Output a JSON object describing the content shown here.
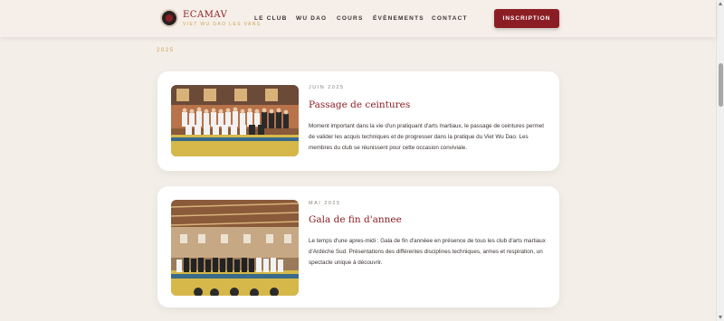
{
  "header": {
    "brand_title": "ECAMAV",
    "brand_subtitle": "VIET WU DAO LES VANS",
    "nav": [
      "LE CLUB",
      "WU DAO",
      "COURS",
      "ÉVÈNEMENTS",
      "CONTACT"
    ],
    "cta_label": "INSCRIPTION"
  },
  "year_label": "2025",
  "events": [
    {
      "date": "JUIN 2025",
      "title": "Passage de ceintures",
      "text": "Moment important dans la vie d'un pratiquant d'arts martiaux, le passage de ceintures permet de valider les acquis techniques et de progresser dans la pratique du Viet Wu Dao. Les membres du club se réunissent pour cette occasion conviviale."
    },
    {
      "date": "MAI 2025",
      "title": "Gala de fin d'annee",
      "text": "Le temps d'une apres-midi : Gala de fin d'annéee en présence de tous les club d'arts martiaux d'Ardèche Sud. Présentations des différentes disciplines techniques, armes et respiration, un spectacle unique à découvrir."
    }
  ],
  "colors": {
    "background": "#f4eee8",
    "brand": "#8b1e24",
    "gold": "#c9a24e",
    "card": "#ffffff"
  }
}
